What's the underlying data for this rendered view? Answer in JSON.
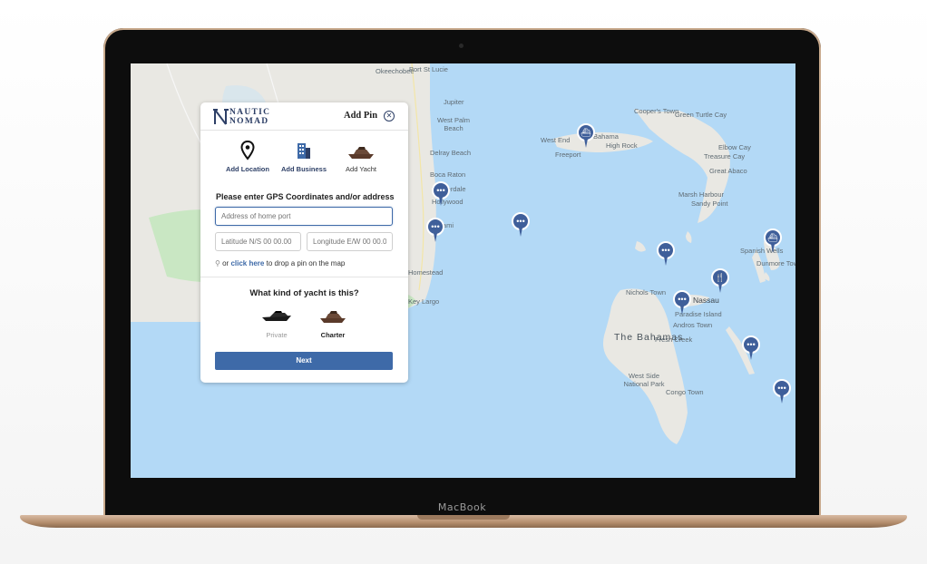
{
  "device": {
    "brand": "MacBook"
  },
  "panel": {
    "logo_line1": "NAUTIC",
    "logo_line2": "NOMAD",
    "title": "Add Pin",
    "close_icon": "close-circle-icon",
    "options": [
      {
        "label": "Add Location",
        "icon": "map-pin-icon"
      },
      {
        "label": "Add Business",
        "icon": "building-icon"
      },
      {
        "label": "Add Yacht",
        "icon": "yacht-icon"
      }
    ],
    "coords_title": "Please enter GPS Coordinates and/or address",
    "address_placeholder": "Address of home port",
    "latitude_placeholder": "Latitude N/S 00 00.00",
    "longitude_placeholder": "Longitude E/W 00 00.00",
    "hint_prefix": "or",
    "hint_link": "click here",
    "hint_suffix": "to drop a pin on the map",
    "yacht_question": "What kind of yacht is this?",
    "yacht_types": [
      {
        "label": "Private",
        "selected": false
      },
      {
        "label": "Charter",
        "selected": true
      }
    ],
    "next_label": "Next"
  },
  "map": {
    "places": [
      "Okeechobee",
      "Port St Lucie",
      "Jupiter",
      "West Palm Beach",
      "Delray Beach",
      "Boca Raton",
      "Lauderdale",
      "Hollywood",
      "Miami",
      "Homestead",
      "Key Largo",
      "Freeport",
      "High Rock",
      "West End",
      "Cooper's Town",
      "Treasure Cay",
      "Green Turtle Cay",
      "Elbow Cay",
      "Great Abaco",
      "Marsh Harbour",
      "Sandy Point",
      "Spanish Wells",
      "Dunmore Town",
      "Nassau",
      "Paradise Island",
      "Nichols Town",
      "Fresh Creek",
      "West Side National Park",
      "Congo Town",
      "Bahama",
      "Andros Town"
    ],
    "region_label": "The Bahamas",
    "pin_icons": [
      "ship-icon",
      "dots-icon",
      "fork-knife-icon"
    ]
  },
  "colors": {
    "brand_navy": "#2d3f66",
    "accent_blue": "#3e6aa8",
    "water": "#b3d9f6",
    "land": "#e9e8e3",
    "pin": "#3f5f9a"
  }
}
